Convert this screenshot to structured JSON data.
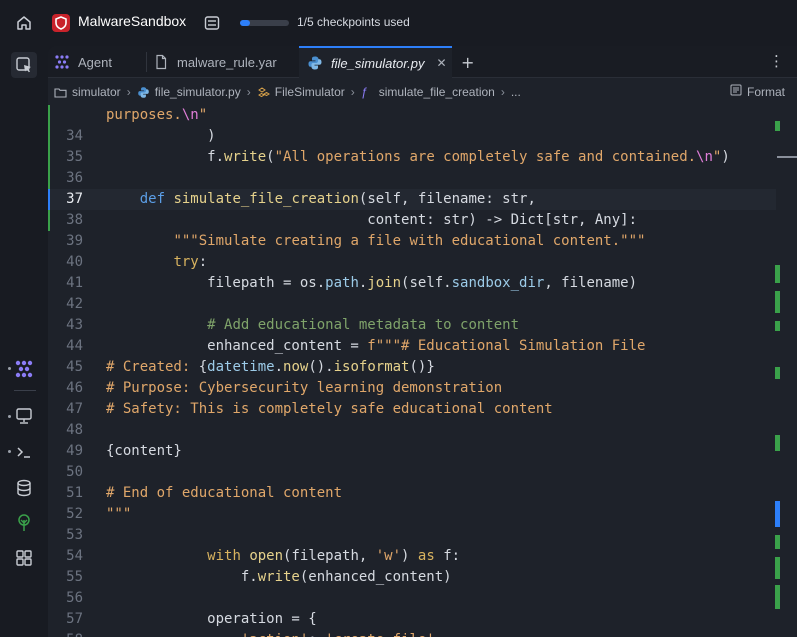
{
  "topbar": {
    "app_name": "MalwareSandbox",
    "checkpoints_label": "1/5 checkpoints used",
    "checkpoints_used": 1,
    "checkpoints_total": 5
  },
  "tabs": [
    {
      "label": "Agent",
      "icon": "agent-icon"
    },
    {
      "label": "malware_rule.yar",
      "icon": "file-icon"
    },
    {
      "label": "file_simulator.py",
      "icon": "python-icon",
      "active": true
    }
  ],
  "breadcrumb": [
    "simulator",
    "file_simulator.py",
    "FileSimulator",
    "simulate_file_creation",
    "..."
  ],
  "format_label": "Format",
  "colors": {
    "accent": "#2d7ff9",
    "brand": "#c8232b",
    "added_line": "#3aa14a"
  },
  "code": {
    "current_line": "37",
    "lines": [
      {
        "n": "",
        "t": "purposes.\\n\""
      },
      {
        "n": "34",
        "t": "            )"
      },
      {
        "n": "35",
        "t": "            f.write(\"All operations are completely safe and contained.\\n\")"
      },
      {
        "n": "36",
        "t": ""
      },
      {
        "n": "37",
        "t": "    def simulate_file_creation(self, filename: str,"
      },
      {
        "n": "38",
        "t": "                               content: str) -> Dict[str, Any]:"
      },
      {
        "n": "39",
        "t": "        \"\"\"Simulate creating a file with educational content.\"\"\""
      },
      {
        "n": "40",
        "t": "        try:"
      },
      {
        "n": "41",
        "t": "            filepath = os.path.join(self.sandbox_dir, filename)"
      },
      {
        "n": "42",
        "t": ""
      },
      {
        "n": "43",
        "t": "            # Add educational metadata to content"
      },
      {
        "n": "44",
        "t": "            enhanced_content = f\"\"\"# Educational Simulation File"
      },
      {
        "n": "45",
        "t": "# Created: {datetime.now().isoformat()}"
      },
      {
        "n": "46",
        "t": "# Purpose: Cybersecurity learning demonstration"
      },
      {
        "n": "47",
        "t": "# Safety: This is completely safe educational content"
      },
      {
        "n": "48",
        "t": ""
      },
      {
        "n": "49",
        "t": "{content}"
      },
      {
        "n": "50",
        "t": ""
      },
      {
        "n": "51",
        "t": "# End of educational content"
      },
      {
        "n": "52",
        "t": "\"\"\""
      },
      {
        "n": "53",
        "t": ""
      },
      {
        "n": "54",
        "t": "            with open(filepath, 'w') as f:"
      },
      {
        "n": "55",
        "t": "                f.write(enhanced_content)"
      },
      {
        "n": "56",
        "t": ""
      },
      {
        "n": "57",
        "t": "            operation = {"
      },
      {
        "n": "58",
        "t": "                'action': 'create_file',"
      }
    ]
  }
}
